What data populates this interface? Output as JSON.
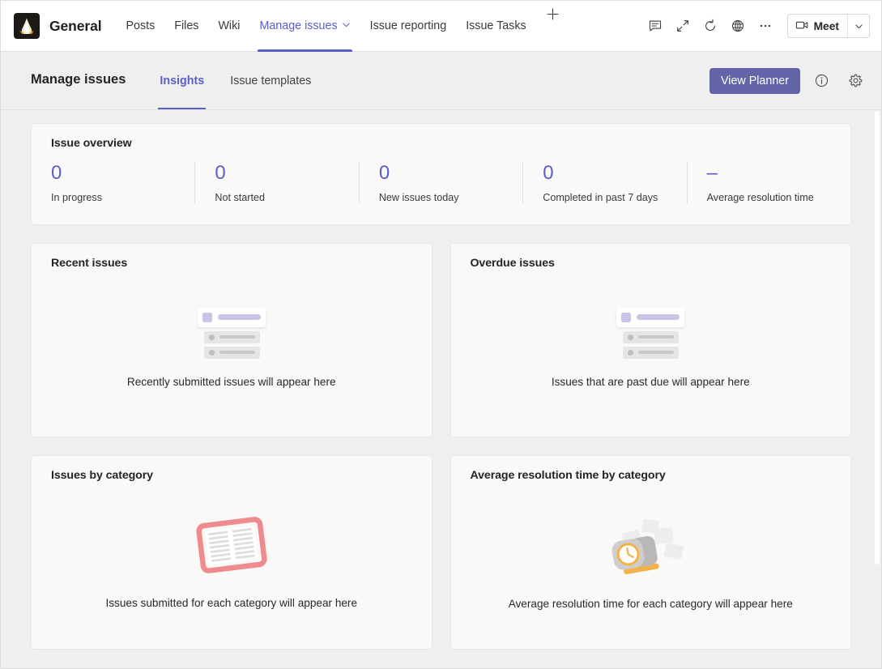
{
  "window": {
    "team_name": "General",
    "avatar_icon": "team-flame-avatar"
  },
  "channel_tabs": [
    {
      "label": "Posts",
      "active": false,
      "has_chevron": false
    },
    {
      "label": "Files",
      "active": false,
      "has_chevron": false
    },
    {
      "label": "Wiki",
      "active": false,
      "has_chevron": false
    },
    {
      "label": "Manage issues",
      "active": true,
      "has_chevron": true
    },
    {
      "label": "Issue reporting",
      "active": false,
      "has_chevron": false
    },
    {
      "label": "Issue Tasks",
      "active": false,
      "has_chevron": false
    }
  ],
  "topbar_actions": {
    "add_tab_icon": "plus-icon",
    "icons": [
      {
        "name": "chat-icon"
      },
      {
        "name": "expand-icon"
      },
      {
        "name": "refresh-icon"
      },
      {
        "name": "globe-icon"
      },
      {
        "name": "more-options-icon"
      }
    ],
    "meet_label": "Meet",
    "meet_icon": "video-camera-icon",
    "meet_chevron_icon": "chevron-down-icon"
  },
  "app": {
    "title": "Manage issues",
    "tabs": [
      {
        "label": "Insights",
        "active": true
      },
      {
        "label": "Issue templates",
        "active": false
      }
    ],
    "planner_button": "View Planner",
    "info_icon": "info-circle-icon",
    "settings_icon": "gear-icon",
    "accent_color": "#5b5fc7",
    "button_color": "#6264a7"
  },
  "overview": {
    "title": "Issue overview",
    "stats": [
      {
        "value": "0",
        "label": "In progress"
      },
      {
        "value": "0",
        "label": "Not started"
      },
      {
        "value": "0",
        "label": "New issues today"
      },
      {
        "value": "0",
        "label": "Completed in past 7 days"
      },
      {
        "value": "–",
        "label": "Average resolution time"
      }
    ]
  },
  "panels": [
    {
      "title": "Recent issues",
      "empty_text": "Recently submitted issues will appear here",
      "illustration": "list-empty-illustration"
    },
    {
      "title": "Overdue issues",
      "empty_text": "Issues that are past due will appear here",
      "illustration": "list-empty-illustration"
    },
    {
      "title": "Issues by category",
      "empty_text": "Issues submitted for each category will appear here",
      "illustration": "open-book-illustration"
    },
    {
      "title": "Average resolution time by category",
      "empty_text": "Average resolution time for each category will appear here",
      "illustration": "clock-illustration"
    }
  ]
}
